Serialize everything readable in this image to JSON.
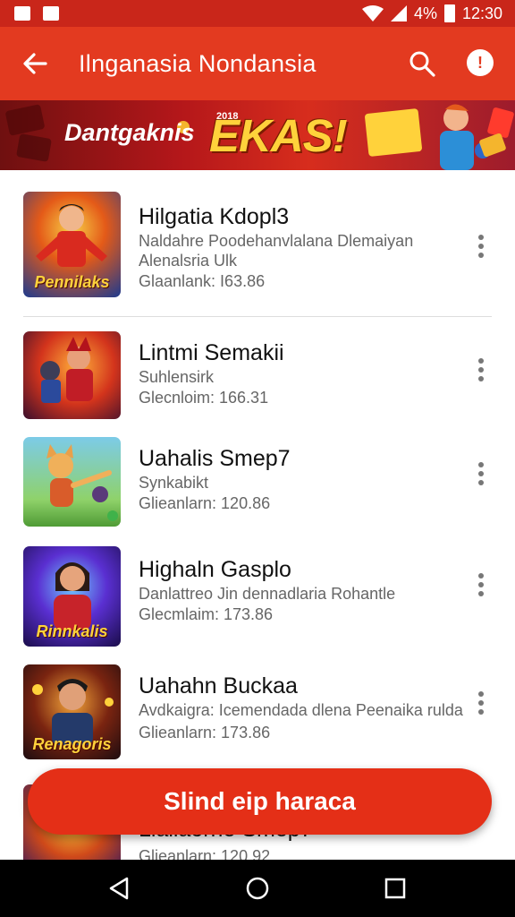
{
  "status_bar": {
    "battery": "4%",
    "time": "12:30"
  },
  "app_bar": {
    "title": "Ilnganasia Nondansia"
  },
  "banner": {
    "left_text": "Dantgaknis",
    "main_text": "EKAS!",
    "badge_text": "2018"
  },
  "items": [
    {
      "name": "Hilgatia Kdopl3",
      "subtitle_line1": "Naldahre Poodehanvlalana Dlemaiyan",
      "subtitle_line2": "Alenalsria Ulk",
      "meta": "Glaanlank: I63.86",
      "thumb_label": "Pennilaks"
    },
    {
      "name": "Lintmi Semakii",
      "subtitle_line1": "Suhlensirk",
      "subtitle_line2": "",
      "meta": "Glecnloim: 166.31",
      "thumb_label": ""
    },
    {
      "name": "Uahalis Smep7",
      "subtitle_line1": "Synkabikt",
      "subtitle_line2": "",
      "meta": "Glieanlarn: 120.86",
      "thumb_label": ""
    },
    {
      "name": "Highaln Gasplo",
      "subtitle_line1": "Danlattreo Jin dennadlaria Rohantle",
      "subtitle_line2": "",
      "meta": "Glecmlaim: 173.86",
      "thumb_label": "Rinnkalis"
    },
    {
      "name": "Uahahn Buckaa",
      "subtitle_line1": "Avdkaigra: Icemendada dlena Peenaika rulda",
      "subtitle_line2": "",
      "meta": "Glieanlarn: 173.86",
      "thumb_label": "Renagoris"
    },
    {
      "name": "Lialiaorrie Smep7",
      "subtitle_line1": "",
      "subtitle_line2": "",
      "meta": "Glieanlarn: 120.92",
      "thumb_label": ""
    }
  ],
  "fab": {
    "label": "Slind eip haraca"
  },
  "colors": {
    "status_bar": "#c9261a",
    "app_bar": "#e33a20",
    "fab": "#e42f17"
  }
}
